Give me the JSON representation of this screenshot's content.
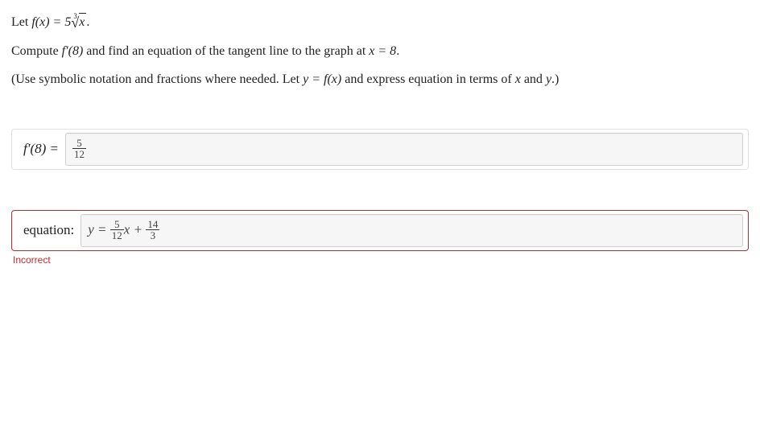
{
  "problem": {
    "line1_pre": "Let ",
    "line1_fn": "f(x) = 5",
    "line1_root_index": "3",
    "line1_radicand": "x",
    "line1_post": ".",
    "line2_a": "Compute ",
    "line2_b": "f′(8)",
    "line2_c": " and find an equation of the tangent line to the graph at ",
    "line2_d": "x = 8",
    "line2_e": ".",
    "line3_a": "(Use symbolic notation and fractions where needed. Let ",
    "line3_b": "y = f(x)",
    "line3_c": " and express equation in terms of ",
    "line3_d": "x",
    "line3_e": " and ",
    "line3_f": "y",
    "line3_g": ".)"
  },
  "answers": {
    "fprime": {
      "label_lhs": "f′(8) =",
      "value_num": "5",
      "value_den": "12"
    },
    "equation": {
      "label": "equation:",
      "prefix": "y = ",
      "term1_num": "5",
      "term1_den": "12",
      "mid": "x + ",
      "term2_num": "14",
      "term2_den": "3",
      "feedback": "Incorrect"
    }
  }
}
